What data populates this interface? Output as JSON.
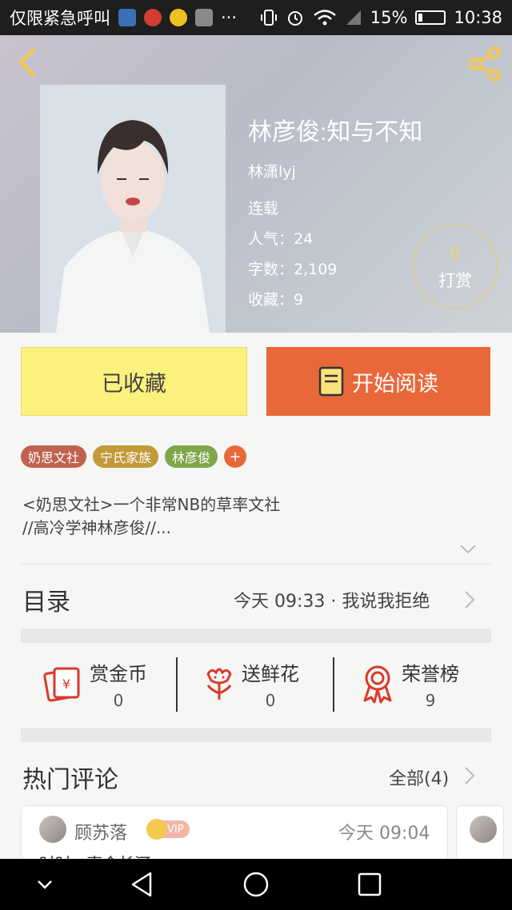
{
  "status_bar": {
    "carrier_text": "仅限紧急呼叫",
    "more": "···",
    "battery": "15%",
    "time": "10:38",
    "icons": [
      "app-icon",
      "netease-music-icon",
      "qq-icon",
      "gallery-icon",
      "vibrate-icon",
      "alarm-icon",
      "wifi-icon",
      "signal-icon",
      "battery-icon"
    ]
  },
  "book": {
    "title": "林彦俊:知与不知",
    "author": "林潇lyj",
    "status": "连载",
    "popularity": "人气：24",
    "word_count": "字数：2,109",
    "favorites": "收藏：9",
    "reward_count": "0",
    "reward_label": "打赏"
  },
  "actions": {
    "favorited_label": "已收藏",
    "read_label": "开始阅读"
  },
  "tags": [
    {
      "label": "奶思文社",
      "color": "#c0624c"
    },
    {
      "label": "宁氏家族",
      "color": "#c29a3a"
    },
    {
      "label": "林彦俊",
      "color": "#7ea64a"
    }
  ],
  "tag_add": "+",
  "intro": {
    "line1": "<奶思文社>一个非常NB的草率文社",
    "line2": "//高冷学神林彦俊//..."
  },
  "toc": {
    "label": "目录",
    "latest": "今天 09:33 · 我说我拒绝"
  },
  "stats": [
    {
      "label": "赏金币",
      "value": "0",
      "icon": "red-envelope-icon"
    },
    {
      "label": "送鲜花",
      "value": "0",
      "icon": "flower-icon"
    },
    {
      "label": "荣誉榜",
      "value": "9",
      "icon": "medal-icon"
    }
  ],
  "hot_comments": {
    "label": "热门评论",
    "all_label": "全部(4)",
    "items": [
      {
        "name": "顾苏落",
        "badge": "VIP",
        "time": "今天 09:04",
        "text": "时时 · 声会长河"
      }
    ]
  },
  "colors": {
    "accent_orange": "#e8683a",
    "fav_yellow": "#fbf17d",
    "gold": "#f3d26c",
    "icon_red": "#d93a2b"
  }
}
